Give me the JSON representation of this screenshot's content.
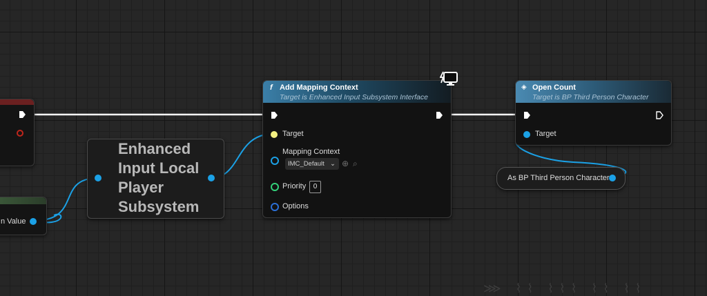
{
  "nodes": {
    "add_mapping_context": {
      "title": "Add Mapping Context",
      "subtitle": "Target is Enhanced Input Subsystem Interface",
      "function_symbol": "f",
      "pins": {
        "target": "Target",
        "mapping_context": "Mapping Context",
        "mapping_context_value": "IMC_Default",
        "priority": "Priority",
        "priority_value": "0",
        "options": "Options"
      }
    },
    "open_count": {
      "title": "Open Count",
      "subtitle": "Target is BP Third Person Character",
      "pins": {
        "target": "Target"
      }
    },
    "enhanced_input_subsystem": {
      "title_lines": [
        "Enhanced",
        "Input Local",
        "Player",
        "Subsystem"
      ]
    },
    "cast_node": {
      "label": "As BP Third Person Character"
    },
    "return_node": {
      "label": "n Value"
    }
  },
  "colors": {
    "exec": "#ffffff",
    "object_pin": "#1ba1e6",
    "target_pin": "#f3f082",
    "int_pin": "#33d17a",
    "struct_pin": "#2b6fd6",
    "background": "#262626"
  }
}
